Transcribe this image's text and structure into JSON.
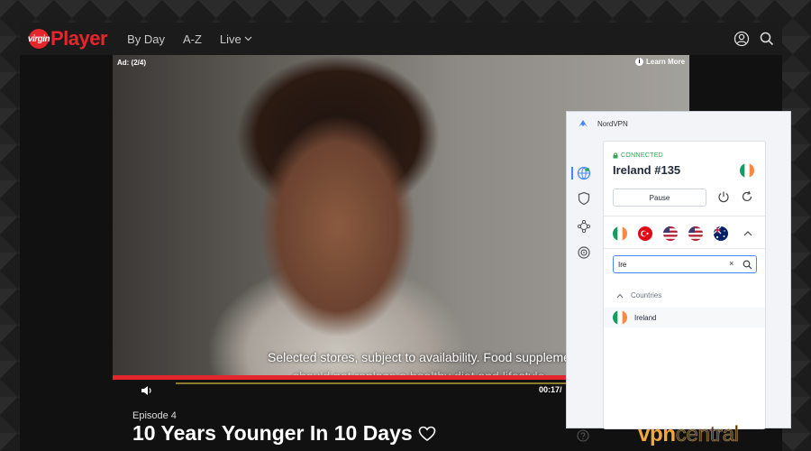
{
  "header": {
    "logo_text": "Player",
    "logo_badge": "virgin",
    "nav": [
      {
        "label": "By Day"
      },
      {
        "label": "A-Z"
      },
      {
        "label": "Live"
      }
    ]
  },
  "video": {
    "ad_label": "Ad: (2/4)",
    "learn_more": "Learn More",
    "subtitle_line1": "Selected stores, subject to availability. Food supplements",
    "subtitle_line2": "should not replace a healthy diet and lifestyle.",
    "time": "00:17/",
    "progress_fraction": 1.0
  },
  "program": {
    "episode": "Episode 4",
    "title": "10 Years Younger In 10 Days"
  },
  "nordvpn": {
    "app_name": "NordVPN",
    "status": "CONNECTED",
    "server": "Ireland #135",
    "pause_label": "Pause",
    "recent_flags": [
      "ireland",
      "turkey",
      "united-states",
      "united-states",
      "australia"
    ],
    "search_value": "Ire",
    "section_label": "Countries",
    "result_country": "Ireland",
    "accent_color": "#4687ff",
    "connected_color": "#2fa84f"
  },
  "watermark": {
    "part1": "vpn",
    "part2": "central"
  },
  "colors": {
    "brand_red": "#e5262d"
  }
}
